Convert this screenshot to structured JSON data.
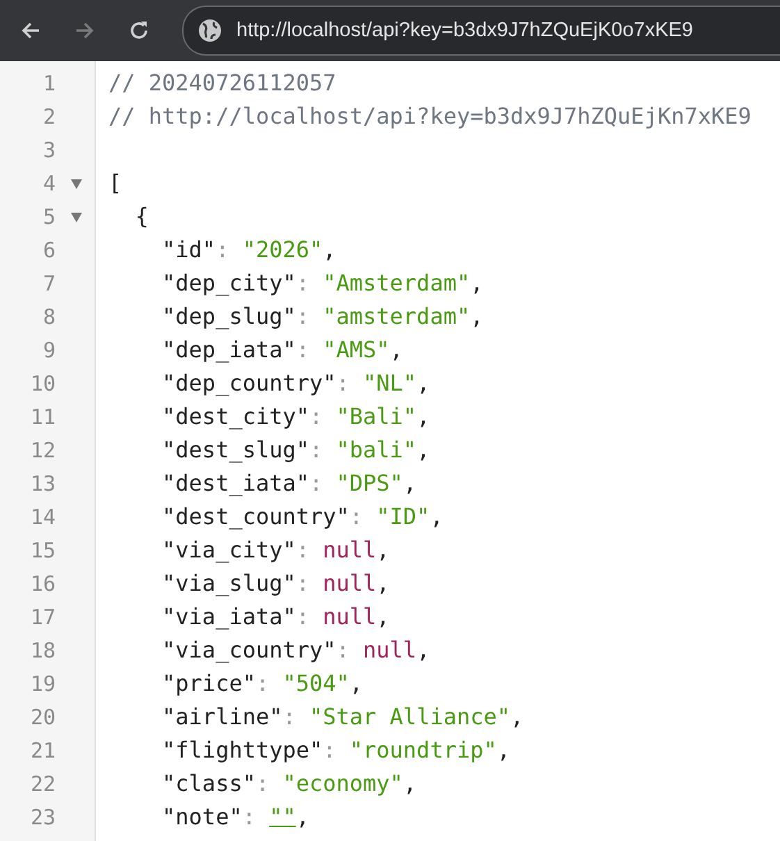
{
  "browser": {
    "address": "http://localhost/api?key=b3dx9J7hZQuEjK0o7xKE9",
    "back_enabled": true,
    "forward_enabled": false
  },
  "editor": {
    "lines": [
      {
        "number": "1",
        "tokens": [
          {
            "kind": "comment",
            "text": "// 20240726112057"
          }
        ]
      },
      {
        "number": "2",
        "tokens": [
          {
            "kind": "comment",
            "text": "// http://localhost/api?key=b3dx9J7hZQuEjKn7xKE9"
          }
        ]
      },
      {
        "number": "3"
      },
      {
        "number": "4",
        "foldable": true,
        "tokens": [
          {
            "kind": "punct",
            "text": "["
          }
        ],
        "children": [
          {
            "number": "5",
            "foldable": true,
            "tokens": [
              {
                "kind": "punct",
                "text": "{"
              }
            ],
            "children": [
              {
                "number": "6",
                "tokens": [
                  {
                    "kind": "key",
                    "text": "\"id\""
                  },
                  {
                    "kind": "colon",
                    "text": ": "
                  },
                  {
                    "kind": "string",
                    "text": "\"2026\""
                  },
                  {
                    "kind": "punct",
                    "text": ","
                  }
                ]
              },
              {
                "number": "7",
                "tokens": [
                  {
                    "kind": "key",
                    "text": "\"dep_city\""
                  },
                  {
                    "kind": "colon",
                    "text": ": "
                  },
                  {
                    "kind": "string",
                    "text": "\"Amsterdam\""
                  },
                  {
                    "kind": "punct",
                    "text": ","
                  }
                ]
              },
              {
                "number": "8",
                "tokens": [
                  {
                    "kind": "key",
                    "text": "\"dep_slug\""
                  },
                  {
                    "kind": "colon",
                    "text": ": "
                  },
                  {
                    "kind": "string",
                    "text": "\"amsterdam\""
                  },
                  {
                    "kind": "punct",
                    "text": ","
                  }
                ]
              },
              {
                "number": "9",
                "tokens": [
                  {
                    "kind": "key",
                    "text": "\"dep_iata\""
                  },
                  {
                    "kind": "colon",
                    "text": ": "
                  },
                  {
                    "kind": "string",
                    "text": "\"AMS\""
                  },
                  {
                    "kind": "punct",
                    "text": ","
                  }
                ]
              },
              {
                "number": "10",
                "tokens": [
                  {
                    "kind": "key",
                    "text": "\"dep_country\""
                  },
                  {
                    "kind": "colon",
                    "text": ": "
                  },
                  {
                    "kind": "string",
                    "text": "\"NL\""
                  },
                  {
                    "kind": "punct",
                    "text": ","
                  }
                ]
              },
              {
                "number": "11",
                "tokens": [
                  {
                    "kind": "key",
                    "text": "\"dest_city\""
                  },
                  {
                    "kind": "colon",
                    "text": ": "
                  },
                  {
                    "kind": "string",
                    "text": "\"Bali\""
                  },
                  {
                    "kind": "punct",
                    "text": ","
                  }
                ]
              },
              {
                "number": "12",
                "tokens": [
                  {
                    "kind": "key",
                    "text": "\"dest_slug\""
                  },
                  {
                    "kind": "colon",
                    "text": ": "
                  },
                  {
                    "kind": "string",
                    "text": "\"bali\""
                  },
                  {
                    "kind": "punct",
                    "text": ","
                  }
                ]
              },
              {
                "number": "13",
                "tokens": [
                  {
                    "kind": "key",
                    "text": "\"dest_iata\""
                  },
                  {
                    "kind": "colon",
                    "text": ": "
                  },
                  {
                    "kind": "string",
                    "text": "\"DPS\""
                  },
                  {
                    "kind": "punct",
                    "text": ","
                  }
                ]
              },
              {
                "number": "14",
                "tokens": [
                  {
                    "kind": "key",
                    "text": "\"dest_country\""
                  },
                  {
                    "kind": "colon",
                    "text": ": "
                  },
                  {
                    "kind": "string",
                    "text": "\"ID\""
                  },
                  {
                    "kind": "punct",
                    "text": ","
                  }
                ]
              },
              {
                "number": "15",
                "tokens": [
                  {
                    "kind": "key",
                    "text": "\"via_city\""
                  },
                  {
                    "kind": "colon",
                    "text": ": "
                  },
                  {
                    "kind": "null",
                    "text": "null"
                  },
                  {
                    "kind": "punct",
                    "text": ","
                  }
                ]
              },
              {
                "number": "16",
                "tokens": [
                  {
                    "kind": "key",
                    "text": "\"via_slug\""
                  },
                  {
                    "kind": "colon",
                    "text": ": "
                  },
                  {
                    "kind": "null",
                    "text": "null"
                  },
                  {
                    "kind": "punct",
                    "text": ","
                  }
                ]
              },
              {
                "number": "17",
                "tokens": [
                  {
                    "kind": "key",
                    "text": "\"via_iata\""
                  },
                  {
                    "kind": "colon",
                    "text": ": "
                  },
                  {
                    "kind": "null",
                    "text": "null"
                  },
                  {
                    "kind": "punct",
                    "text": ","
                  }
                ]
              },
              {
                "number": "18",
                "tokens": [
                  {
                    "kind": "key",
                    "text": "\"via_country\""
                  },
                  {
                    "kind": "colon",
                    "text": ": "
                  },
                  {
                    "kind": "null",
                    "text": "null"
                  },
                  {
                    "kind": "punct",
                    "text": ","
                  }
                ]
              },
              {
                "number": "19",
                "tokens": [
                  {
                    "kind": "key",
                    "text": "\"price\""
                  },
                  {
                    "kind": "colon",
                    "text": ": "
                  },
                  {
                    "kind": "string",
                    "text": "\"504\""
                  },
                  {
                    "kind": "punct",
                    "text": ","
                  }
                ]
              },
              {
                "number": "20",
                "tokens": [
                  {
                    "kind": "key",
                    "text": "\"airline\""
                  },
                  {
                    "kind": "colon",
                    "text": ": "
                  },
                  {
                    "kind": "string",
                    "text": "\"Star Alliance\""
                  },
                  {
                    "kind": "punct",
                    "text": ","
                  }
                ]
              },
              {
                "number": "21",
                "tokens": [
                  {
                    "kind": "key",
                    "text": "\"flighttype\""
                  },
                  {
                    "kind": "colon",
                    "text": ": "
                  },
                  {
                    "kind": "string",
                    "text": "\"roundtrip\""
                  },
                  {
                    "kind": "punct",
                    "text": ","
                  }
                ]
              },
              {
                "number": "22",
                "tokens": [
                  {
                    "kind": "key",
                    "text": "\"class\""
                  },
                  {
                    "kind": "colon",
                    "text": ": "
                  },
                  {
                    "kind": "string",
                    "text": "\"economy\""
                  },
                  {
                    "kind": "punct",
                    "text": ","
                  }
                ]
              },
              {
                "number": "23",
                "tokens": [
                  {
                    "kind": "key",
                    "text": "\"note\""
                  },
                  {
                    "kind": "colon",
                    "text": ": "
                  },
                  {
                    "kind": "empty-string",
                    "text": "\"\""
                  },
                  {
                    "kind": "punct",
                    "text": ","
                  }
                ]
              }
            ]
          }
        ]
      }
    ]
  }
}
